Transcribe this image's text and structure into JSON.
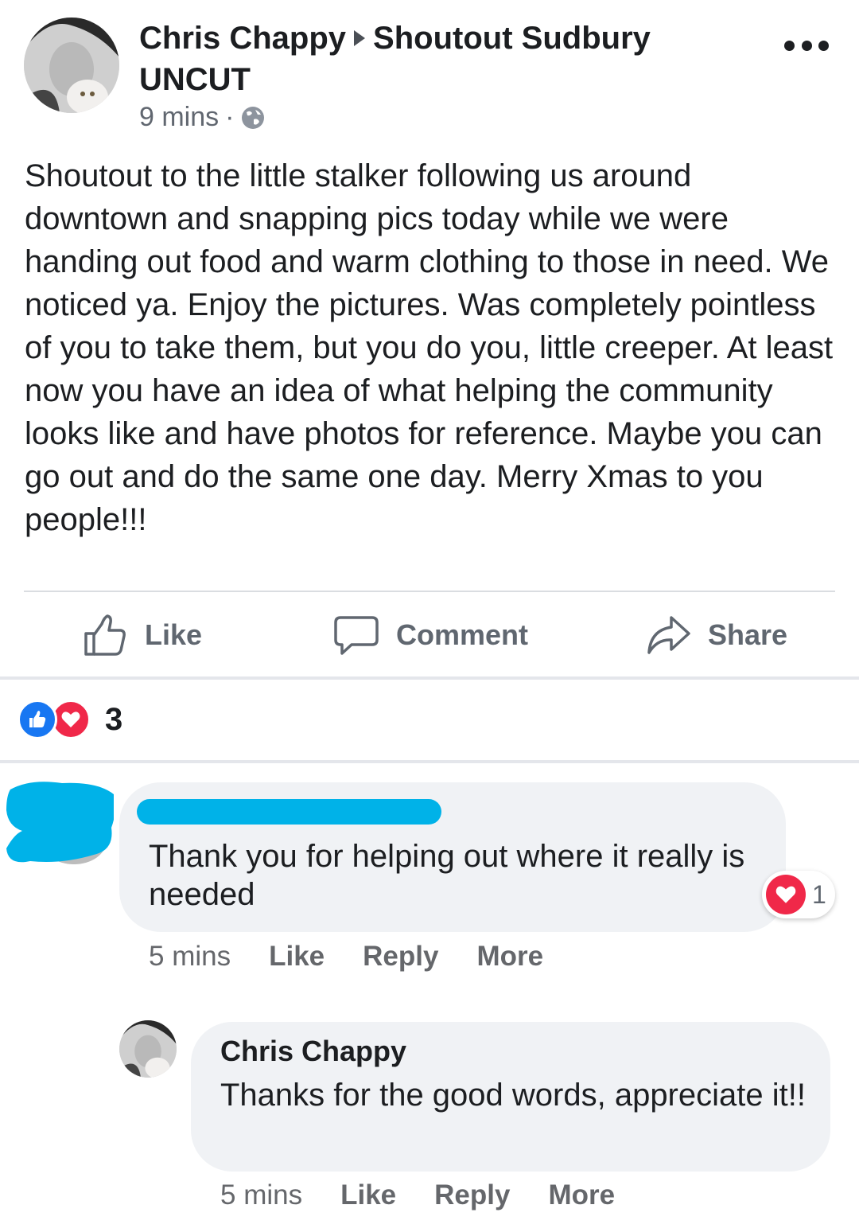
{
  "post": {
    "author": "Chris Chappy",
    "group": "Shoutout Sudbury UNCUT",
    "time": "9 mins",
    "separator": "·",
    "privacy_icon": "globe-icon",
    "menu_icon": "more-dots-icon",
    "text": "Shoutout to the little stalker following us around downtown and snapping pics today while we were handing out food and warm clothing to those in need. We noticed ya. Enjoy the pictures. Was completely pointless of you to take them, but you do you, little creeper. At least now you have an idea of what helping the community looks like and have photos for reference. Maybe you can go out and do the same one day. Merry Xmas to you people!!!"
  },
  "actions": {
    "like": "Like",
    "comment": "Comment",
    "share": "Share"
  },
  "reactions": {
    "count": "3",
    "types": [
      "like",
      "love"
    ]
  },
  "comments": [
    {
      "author": "",
      "author_redacted": true,
      "text": "Thank you for helping out where it really is needed",
      "reaction_count": "1",
      "time": "5 mins",
      "like": "Like",
      "reply": "Reply",
      "more": "More"
    },
    {
      "author": "Chris Chappy",
      "text": "Thanks for the good words, appreciate it!!",
      "time": "5 mins",
      "like": "Like",
      "reply": "Reply",
      "more": "More"
    }
  ],
  "colors": {
    "like_blue": "#1877f2",
    "love_red": "#f02849",
    "redaction": "#00b2e8",
    "bubble": "#f0f2f5",
    "muted_text": "#65676b"
  }
}
